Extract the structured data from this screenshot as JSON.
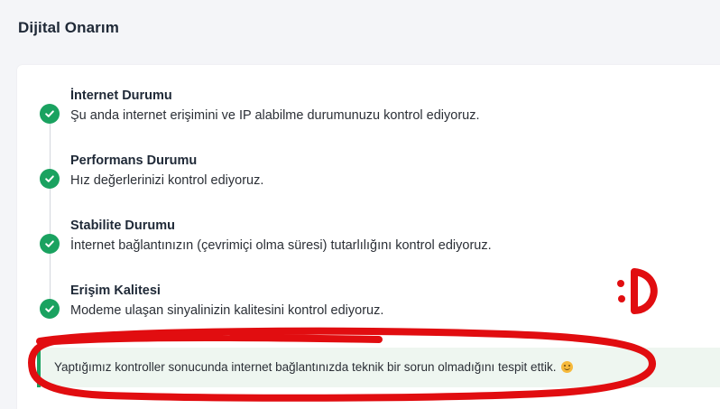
{
  "page": {
    "title": "Dijital Onarım"
  },
  "steps": [
    {
      "title": "İnternet Durumu",
      "description": "Şu anda internet erişimini ve IP alabilme durumunuzu kontrol ediyoruz.",
      "status": "check-circle-icon"
    },
    {
      "title": "Performans Durumu",
      "description": "Hız değerlerinizi kontrol ediyoruz.",
      "status": "check-circle-icon"
    },
    {
      "title": "Stabilite Durumu",
      "description": "İnternet bağlantınızın (çevrimiçi olma süresi) tutarlılığını kontrol ediyoruz.",
      "status": "check-circle-icon"
    },
    {
      "title": "Erişim Kalitesi",
      "description": "Modeme ulaşan sinyalinizin kalitesini kontrol ediyoruz.",
      "status": "check-circle-icon"
    }
  ],
  "result": {
    "message": "Yaptığımız kontroller sonucunda internet bağlantınızda teknik bir sorun olmadığını tespit ettik.",
    "emoji": "smiling-face-icon"
  },
  "colors": {
    "success": "#1aa260",
    "banner_bg": "#eef6f0",
    "annotation": "#e10d10"
  }
}
